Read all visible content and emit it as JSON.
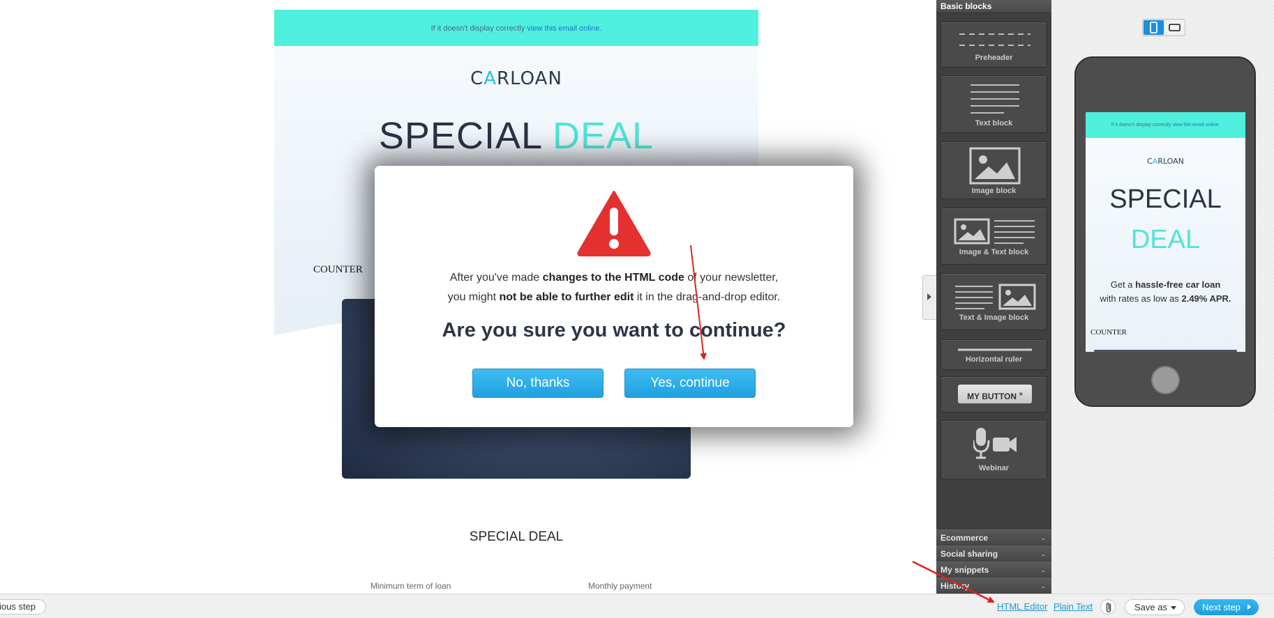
{
  "email": {
    "preheader_text": "If it doesn't display correctly ",
    "preheader_link": "view this email online.",
    "logo_part1": "C",
    "logo_accent": "A",
    "logo_part2": "RLOAN",
    "title_special": "SPECIAL",
    "title_deal": "DEAL",
    "counter_label": "COUNTER",
    "section_title": "SPECIAL DEAL",
    "detail_label_1": "Minimum term of loan",
    "detail_label_2": "Monthly payment"
  },
  "modal": {
    "line1_prefix": "After you've made ",
    "line1_bold": "changes to the HTML code",
    "line1_suffix": " of your newsletter,",
    "line2_prefix": "you might ",
    "line2_bold": "not be able to further edit",
    "line2_suffix": " it in the drag-and-drop editor.",
    "question": "Are you sure you want to continue?",
    "no_label": "No, thanks",
    "yes_label": "Yes, continue"
  },
  "blocks_panel": {
    "header": "Basic blocks",
    "blocks": {
      "preheader": "Preheader",
      "text": "Text block",
      "image": "Image block",
      "image_text": "Image & Text block",
      "text_image": "Text & Image block",
      "ruler": "Horizontal ruler",
      "button": "MY BUTTON",
      "button_suffix": "»",
      "webinar": "Webinar"
    },
    "categories": {
      "ecommerce": "Ecommerce",
      "social": "Social sharing",
      "snippets": "My snippets",
      "history": "History"
    }
  },
  "mobile_preview": {
    "preheader_text": "If it doesn't display correctly ",
    "preheader_link": "view this email online.",
    "logo_part1": "C",
    "logo_accent": "A",
    "logo_part2": "RLOAN",
    "special": "SPECIAL",
    "deal": "DEAL",
    "text1_prefix": "Get a ",
    "text1_bold": "hassle-free car loan",
    "text2_prefix": "with rates as low as ",
    "text2_bold": "2.49% APR.",
    "counter_label": "COUNTER"
  },
  "footer": {
    "prev_step": "ious step",
    "html_editor": "HTML Editor",
    "plain_text": "Plain Text",
    "save_as": "Save as",
    "next_step": "Next step"
  },
  "colors": {
    "accent_teal": "#4ff0de",
    "primary_blue": "#1fa0e0",
    "warning_red": "#e53030",
    "annotation_red": "#e02020"
  },
  "icons": {
    "warning": "warning-triangle-icon",
    "attach": "paperclip-icon",
    "mobile": "mobile-device-icon",
    "desktop": "desktop-device-icon"
  }
}
